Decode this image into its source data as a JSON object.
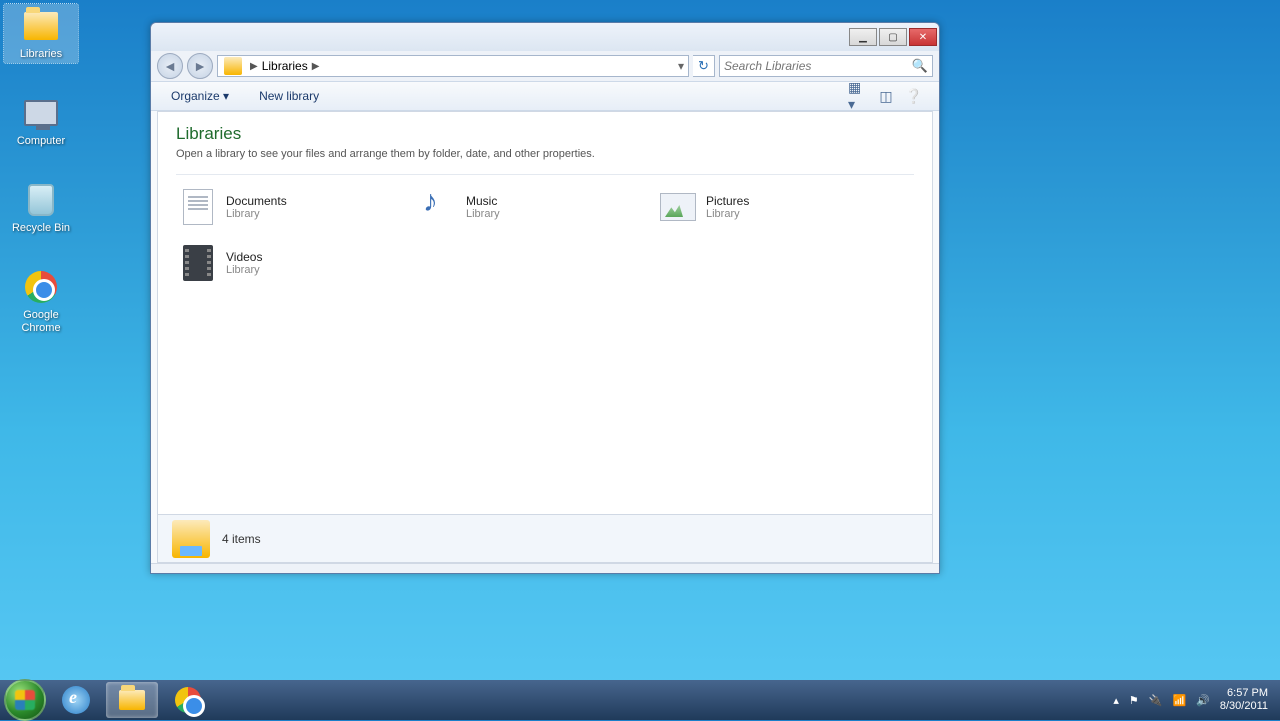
{
  "desktop": {
    "icons": [
      {
        "name": "libraries-desktop-icon",
        "label": "Libraries",
        "selected": true
      },
      {
        "name": "computer-desktop-icon",
        "label": "Computer",
        "selected": false
      },
      {
        "name": "recyclebin-desktop-icon",
        "label": "Recycle Bin",
        "selected": false
      },
      {
        "name": "chrome-desktop-icon",
        "label": "Google Chrome",
        "selected": false
      }
    ]
  },
  "window": {
    "titlebar": {
      "minimize_tip": "Minimize",
      "maximize_tip": "Maximize",
      "close_tip": "Close"
    },
    "nav": {
      "back_tip": "Back",
      "fwd_tip": "Forward",
      "refresh_tip": "Refresh"
    },
    "breadcrumb": {
      "location_label": "Libraries",
      "dropdown_tip": "Previous locations"
    },
    "search": {
      "placeholder": "Search Libraries"
    },
    "toolbar": {
      "organize_label": "Organize",
      "newlib_label": "New library",
      "view_tip": "Change your view",
      "preview_tip": "Show the preview pane",
      "help_tip": "Get help"
    },
    "header": {
      "title": "Libraries",
      "subtitle": "Open a library to see your files and arrange them by folder, date, and other properties."
    },
    "libraries": [
      {
        "name": "Documents",
        "type": "Library",
        "icon": "documents"
      },
      {
        "name": "Music",
        "type": "Library",
        "icon": "music"
      },
      {
        "name": "Pictures",
        "type": "Library",
        "icon": "pictures"
      },
      {
        "name": "Videos",
        "type": "Library",
        "icon": "videos"
      }
    ],
    "status": {
      "text": "4 items"
    }
  },
  "taskbar": {
    "start_tip": "Start",
    "pinned": [
      {
        "name": "ie-taskbar-icon",
        "active": false,
        "icon": "ie"
      },
      {
        "name": "explorer-taskbar-icon",
        "active": true,
        "icon": "folder"
      },
      {
        "name": "chrome-taskbar-icon",
        "active": false,
        "icon": "chrome"
      }
    ],
    "tray": {
      "show_hidden_tip": "Show hidden icons",
      "flag_tip": "Action Center",
      "power_tip": "Power",
      "network_tip": "Network",
      "volume_tip": "Volume",
      "time": "6:57 PM",
      "date": "8/30/2011"
    }
  }
}
